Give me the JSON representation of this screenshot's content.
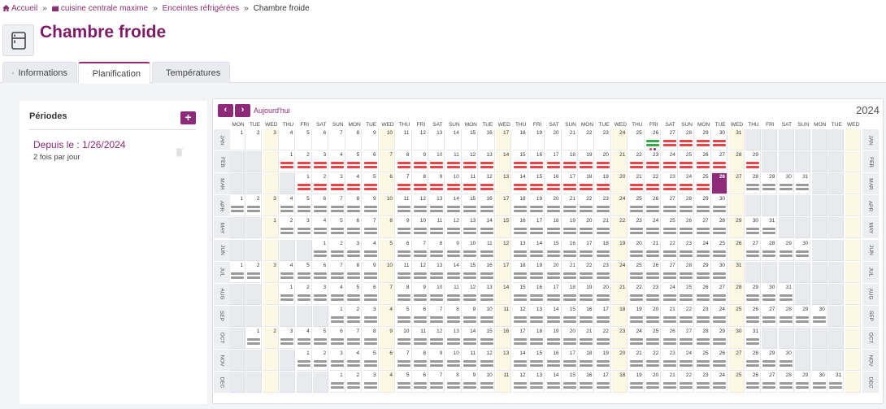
{
  "breadcrumb": {
    "home": "Accueil",
    "site": "cuisine centrale maxime",
    "section": "Enceintes réfrigérées",
    "current": "Chambre froide"
  },
  "page_title": "Chambre froide",
  "tabs": [
    {
      "label": "Informations",
      "icon": "info-icon"
    },
    {
      "label": "Planification",
      "icon": "calendar-icon",
      "active": true
    },
    {
      "label": "Températures",
      "icon": "thermometer-icon"
    }
  ],
  "periods": {
    "title": "Périodes",
    "add_label": "+",
    "items": [
      {
        "title": "Depuis le : 1/26/2024",
        "frequency": "2 fois par jour"
      }
    ]
  },
  "calendar": {
    "prev_label": "‹",
    "next_label": "›",
    "today_label": "Aujourd'hui",
    "year": "2024",
    "weekday_headers": [
      "MON",
      "TUE",
      "WED",
      "THU",
      "FRI",
      "SAT",
      "SUN",
      "MON",
      "TUE",
      "WED",
      "THU",
      "FRI",
      "SAT",
      "SUN",
      "MON",
      "TUE",
      "WED",
      "THU",
      "FRI",
      "SAT",
      "SUN",
      "MON",
      "TUE",
      "WED",
      "THU",
      "FRI",
      "SAT",
      "SUN",
      "MON",
      "TUE",
      "WED",
      "THU",
      "FRI",
      "SAT",
      "SUN",
      "MON",
      "TUE",
      "WED"
    ],
    "months": [
      "JAN",
      "FEB",
      "MAR",
      "APR",
      "MAY",
      "JUN",
      "JUL",
      "AUG",
      "SEP",
      "OCT",
      "NOV",
      "DEC"
    ],
    "month_start_offsets": [
      0,
      3,
      4,
      0,
      2,
      5,
      0,
      3,
      6,
      1,
      4,
      6
    ],
    "month_lengths": [
      31,
      29,
      31,
      30,
      31,
      30,
      31,
      31,
      30,
      31,
      30,
      31
    ],
    "today": {
      "month": 3,
      "day": 26
    },
    "period_start": {
      "month": 1,
      "day": 26
    },
    "status_colors": {
      "missed": "#e54545",
      "planned": "#9a9a9a",
      "done": "#3aa84a",
      "today": "#8e2a78"
    }
  }
}
